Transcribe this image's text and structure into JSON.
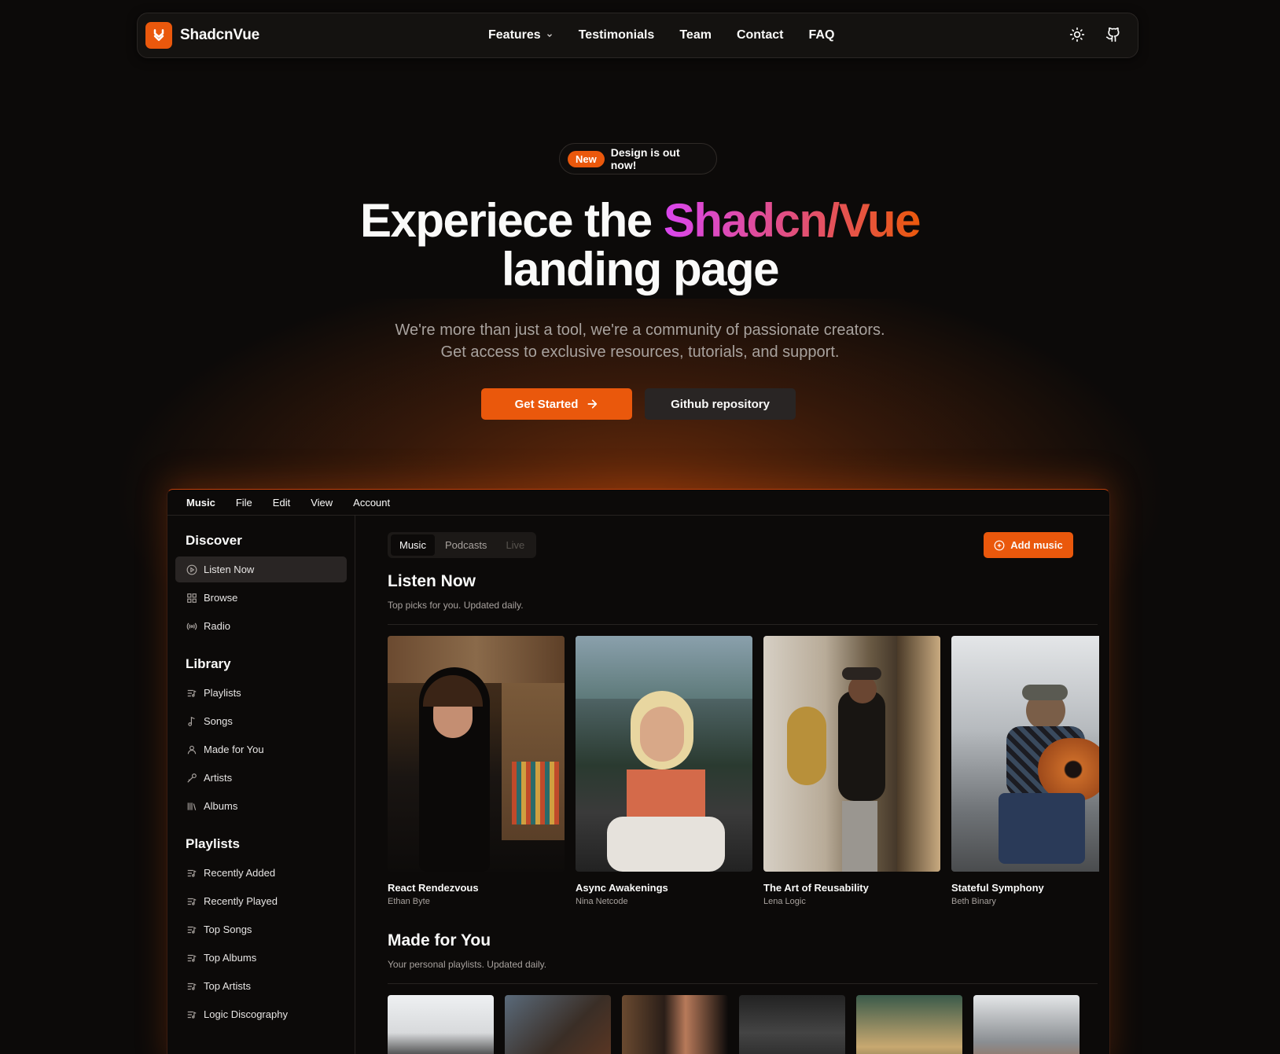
{
  "navbar": {
    "brand": "ShadcnVue",
    "links": [
      "Features",
      "Testimonials",
      "Team",
      "Contact",
      "FAQ"
    ]
  },
  "hero": {
    "badge_pill": "New",
    "badge_text": "Design is out now!",
    "title_part1": "Experiece the ",
    "title_gradient": "Shadcn/Vue",
    "title_part2": "landing page",
    "subtitle_line1": "We're more than just a tool, we're a community of passionate creators.",
    "subtitle_line2": "Get access to exclusive resources, tutorials, and support.",
    "primary_button": "Get Started",
    "secondary_button": "Github repository"
  },
  "app": {
    "menu": [
      "Music",
      "File",
      "Edit",
      "View",
      "Account"
    ],
    "sidebar": {
      "discover_title": "Discover",
      "discover": [
        "Listen Now",
        "Browse",
        "Radio"
      ],
      "library_title": "Library",
      "library": [
        "Playlists",
        "Songs",
        "Made for You",
        "Artists",
        "Albums"
      ],
      "playlists_title": "Playlists",
      "playlists": [
        "Recently Added",
        "Recently Played",
        "Top Songs",
        "Top Albums",
        "Top Artists",
        "Logic Discography"
      ]
    },
    "tabs": [
      "Music",
      "Podcasts",
      "Live"
    ],
    "add_button": "Add music",
    "listen_now": {
      "title": "Listen Now",
      "subtitle": "Top picks for you. Updated daily.",
      "albums": [
        {
          "title": "React Rendezvous",
          "artist": "Ethan Byte"
        },
        {
          "title": "Async Awakenings",
          "artist": "Nina Netcode"
        },
        {
          "title": "The Art of Reusability",
          "artist": "Lena Logic"
        },
        {
          "title": "Stateful Symphony",
          "artist": "Beth Binary"
        }
      ]
    },
    "made_for_you": {
      "title": "Made for You",
      "subtitle": "Your personal playlists. Updated daily."
    }
  },
  "colors": {
    "accent": "#ea580c",
    "background": "#0c0a09",
    "gradient_start": "#d946ef"
  }
}
